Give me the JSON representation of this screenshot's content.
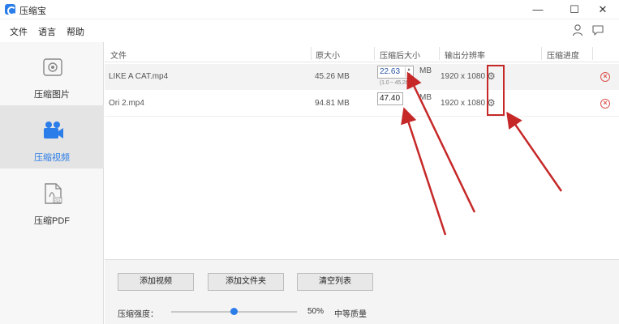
{
  "window": {
    "title": "压缩宝",
    "minimize_glyph": "—",
    "maximize_glyph": "☐",
    "close_glyph": "✕"
  },
  "menu": {
    "file": "文件",
    "language": "语言",
    "help": "帮助"
  },
  "sidebar": {
    "items": [
      {
        "label": "压缩图片",
        "icon": "image-icon",
        "active": false
      },
      {
        "label": "压缩视频",
        "icon": "video-icon",
        "active": true
      },
      {
        "label": "压缩PDF",
        "icon": "pdf-icon",
        "active": false
      }
    ]
  },
  "table": {
    "headers": {
      "file": "文件",
      "original": "原大小",
      "compressed": "压缩后大小",
      "resolution": "输出分辨率",
      "progress": "压缩进度"
    },
    "rows": [
      {
        "name": "LIKE A CAT.mp4",
        "original": "45.26 MB",
        "compressed": "22.63",
        "unit": "MB",
        "range": "(1.0 ~ 45.26MB)",
        "resolution": "1920 x 1080"
      },
      {
        "name": "Ori 2.mp4",
        "original": "94.81 MB",
        "compressed": "47.40",
        "unit": "MB",
        "resolution": "1920 x 1080"
      }
    ]
  },
  "bottom": {
    "add_video": "添加视频",
    "add_folder": "添加文件夹",
    "clear_list": "清空列表",
    "quality_label": "压缩强度：",
    "quality_value": "50%",
    "quality_level": 0.5,
    "quality_name": "中等质量"
  },
  "colors": {
    "accent": "#2b7de9",
    "annotation": "#c62828",
    "remove": "#d9534f"
  }
}
